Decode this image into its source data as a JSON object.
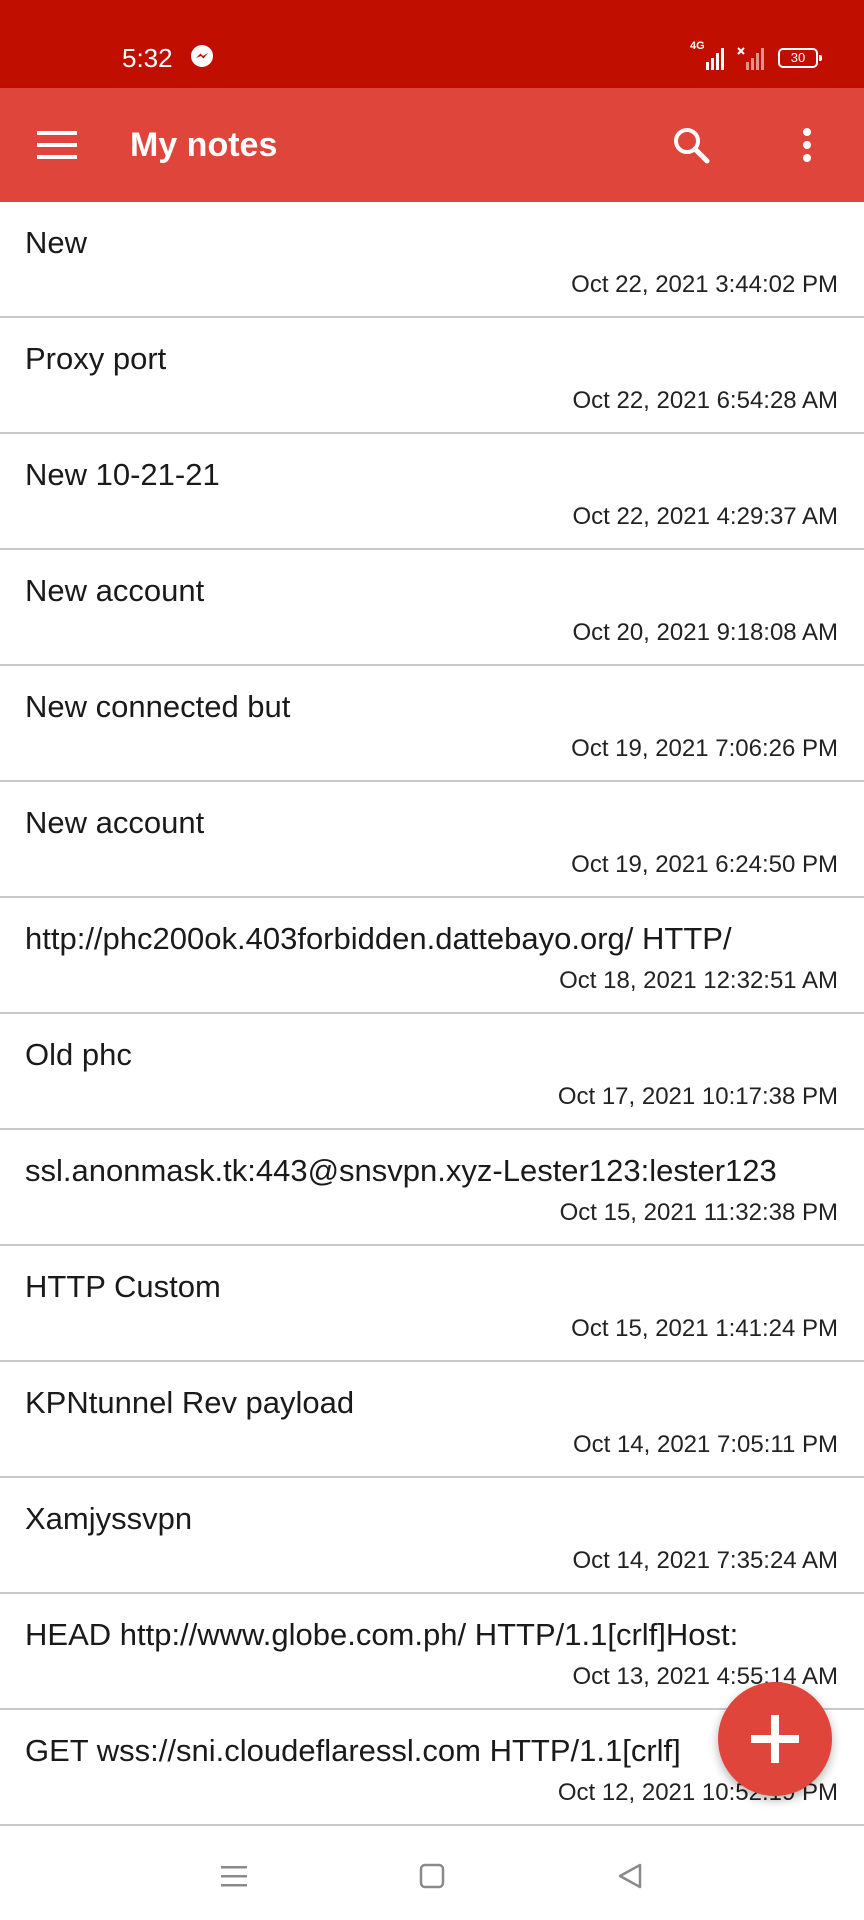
{
  "status_bar": {
    "time": "5:32",
    "network_label": "4G",
    "battery_level": "30",
    "color": "#c00f00"
  },
  "app_bar": {
    "title": "My notes",
    "color": "#e0453b",
    "icons": [
      "menu-icon",
      "search-icon",
      "more-vert-icon"
    ]
  },
  "notes": [
    {
      "title": "New",
      "date": "Oct 22, 2021 3:44:02 PM"
    },
    {
      "title": "Proxy port",
      "date": "Oct 22, 2021 6:54:28 AM"
    },
    {
      "title": "New 10-21-21",
      "date": "Oct 22, 2021 4:29:37 AM"
    },
    {
      "title": "New account",
      "date": "Oct 20, 2021 9:18:08 AM"
    },
    {
      "title": "New connected but",
      "date": "Oct 19, 2021 7:06:26 PM"
    },
    {
      "title": "New account",
      "date": "Oct 19, 2021 6:24:50 PM"
    },
    {
      "title": "http://phc200ok.403forbidden.dattebayo.org/ HTTP/",
      "date": "Oct 18, 2021 12:32:51 AM"
    },
    {
      "title": "Old phc",
      "date": "Oct 17, 2021 10:17:38 PM"
    },
    {
      "title": "ssl.anonmask.tk:443@snsvpn.xyz-Lester123:lester123",
      "date": "Oct 15, 2021 11:32:38 PM"
    },
    {
      "title": "HTTP Custom",
      "date": "Oct 15, 2021 1:41:24 PM"
    },
    {
      "title": "KPNtunnel Rev payload",
      "date": "Oct 14, 2021 7:05:11 PM"
    },
    {
      "title": "Xamjyssvpn",
      "date": "Oct 14, 2021 7:35:24 AM"
    },
    {
      "title": "HEAD http://www.globe.com.ph/ HTTP/1.1[crlf]Host:",
      "date": "Oct 13, 2021 4:55:14 AM"
    },
    {
      "title": "GET wss://sni.cloudeflaressl.com  HTTP/1.1[crlf]",
      "date": "Oct 12, 2021 10:52:19 PM"
    }
  ],
  "fab": {
    "icon": "plus-icon",
    "color": "#e0453b"
  },
  "nav_bar": {
    "icons": [
      "recents-icon",
      "home-icon",
      "back-icon"
    ]
  }
}
